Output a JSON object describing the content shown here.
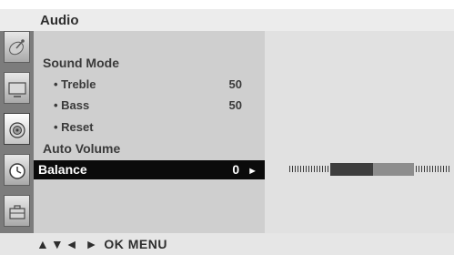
{
  "header": {
    "title": "Audio"
  },
  "icon_rail": {
    "icons": [
      {
        "name": "satellite-dish-icon"
      },
      {
        "name": "tv-screen-icon"
      },
      {
        "name": "speaker-icon"
      },
      {
        "name": "clock-icon"
      },
      {
        "name": "briefcase-icon"
      }
    ],
    "active_icon": "speaker-icon"
  },
  "menu": {
    "sound_mode": {
      "label": "Sound Mode"
    },
    "treble": {
      "label": "• Treble",
      "value": "50"
    },
    "bass": {
      "label": "• Bass",
      "value": "50"
    },
    "reset": {
      "label": "• Reset"
    },
    "auto_volume": {
      "label": "Auto Volume"
    },
    "balance": {
      "label": "Balance",
      "value": "0",
      "arrow": "►"
    }
  },
  "balance_indicator": {
    "value": 0,
    "min": -50,
    "max": 50
  },
  "footer": {
    "arrows": "▲▼◄ ►",
    "hint": "OK  MENU"
  },
  "colors": {
    "selected_row_bg": "#0b0b0b",
    "menu_panel_bg": "#cfcfcf",
    "detail_panel_bg": "#e1e1e1"
  }
}
